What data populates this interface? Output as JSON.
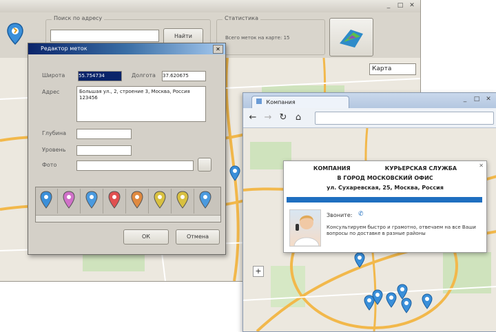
{
  "app": {
    "toolbar": {
      "search_group_label": "Поиск по адресу",
      "search_value": "",
      "find_button": "Найти",
      "info_group_label": "Статистика",
      "info_text": "Всего меток на карте: 15"
    },
    "map_type_select": "Карта"
  },
  "dialog": {
    "title": "Редактор меток",
    "latitude_label": "Широта",
    "latitude_value": "55.754734",
    "longitude_label": "Долгота",
    "longitude_value": "37.620675",
    "address_label": "Адрес",
    "address_value": "Большая ул., 2, строение 3, Москва, Россия 123456",
    "field_labels": [
      "Глубина",
      "Уровень",
      "Фото"
    ],
    "ok_button": "ОК",
    "cancel_button": "Отмена",
    "pin_colors": [
      "#3a8fd9",
      "#d070c8",
      "#4a9adf",
      "#e05050",
      "#e08a40",
      "#d8c040",
      "#d8c040",
      "#4a9adf"
    ]
  },
  "browser": {
    "tab_title": "Компания",
    "popup": {
      "company_line": "КОМПАНИЯ                  КУРЬЕРСКАЯ СЛУЖБА",
      "tagline": "В ГОРОД МОСКОВСКИЙ ОФИС",
      "address": "ул. Сухаревская, 25, Москва, Россия",
      "contact_label": "Звоните:",
      "description": "Консультируем быстро и грамотно, отвечаем на все Ваши вопросы по доставке в разные районы"
    }
  },
  "colors": {
    "app_bg": "#d9d5cc",
    "map_bg": "#ece8df",
    "road": "#f2b84b",
    "pin": "#3a8fd9",
    "popup_bar": "#1f6fc0"
  }
}
